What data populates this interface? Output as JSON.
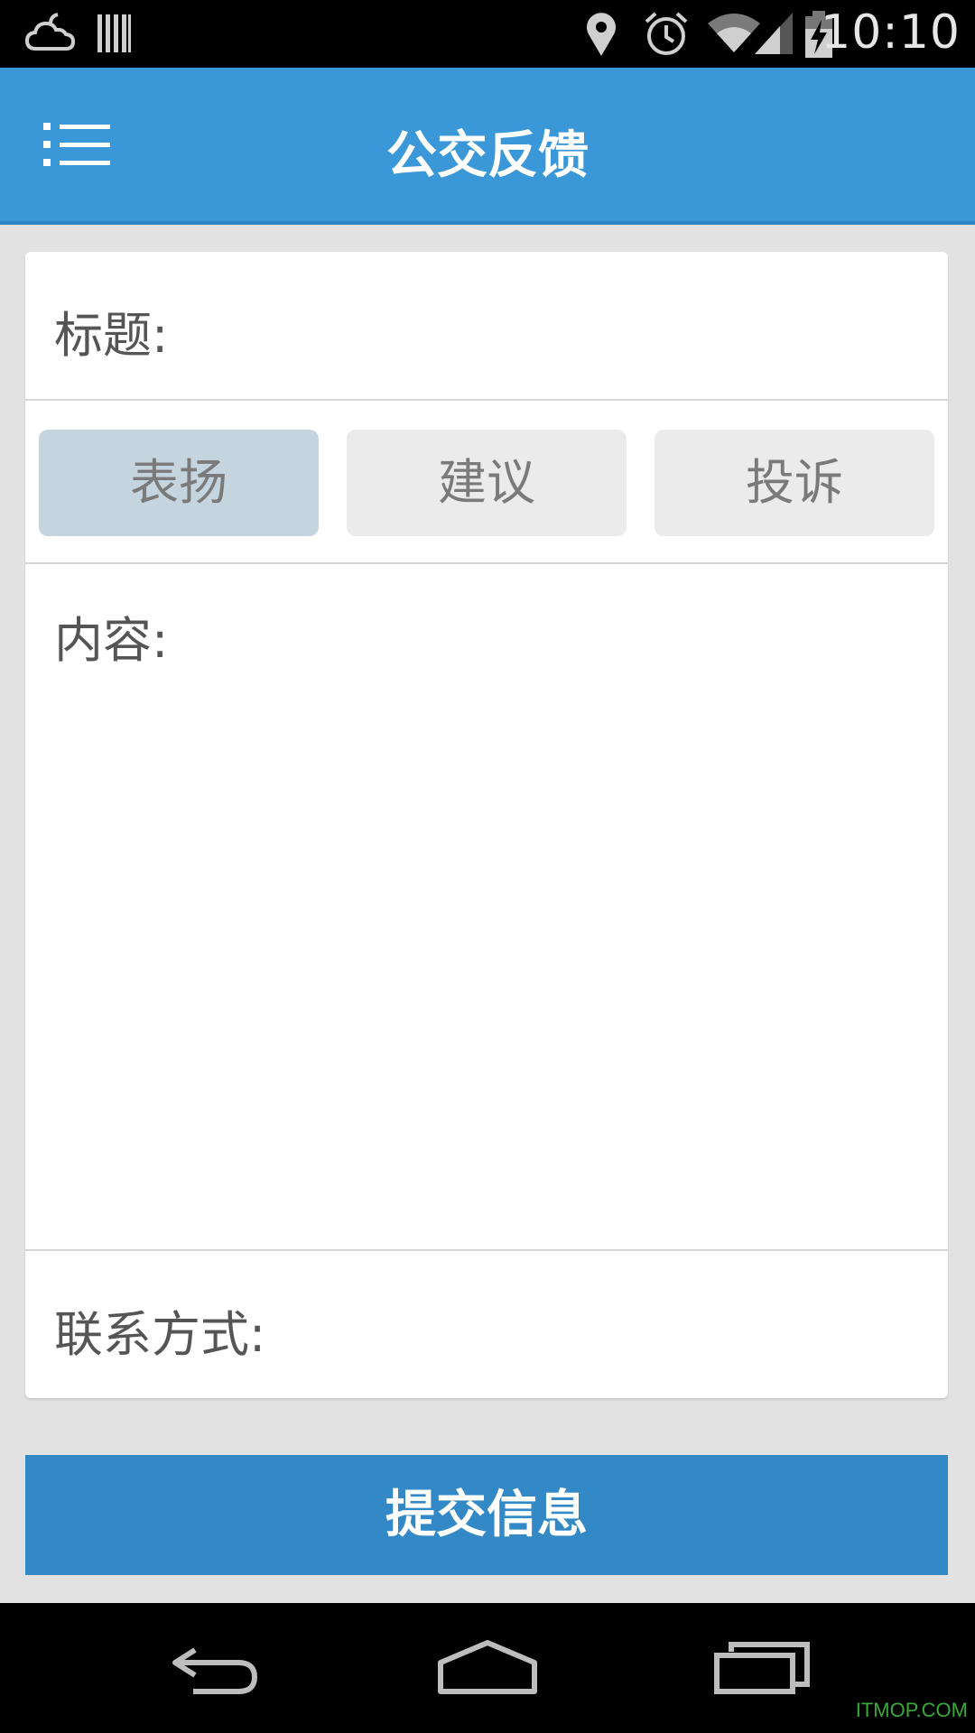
{
  "status_bar": {
    "time": "10:10",
    "icons": [
      "weather-cloud-icon",
      "barcode-icon",
      "location-pin-icon",
      "alarm-icon",
      "wifi-icon",
      "signal-icon",
      "battery-charging-icon"
    ]
  },
  "app_bar": {
    "title": "公交反馈",
    "menu_icon": "menu-list-icon"
  },
  "form": {
    "title_label": "标题:",
    "type_options": [
      {
        "label": "表扬",
        "selected": true
      },
      {
        "label": "建议",
        "selected": false
      },
      {
        "label": "投诉",
        "selected": false
      }
    ],
    "content_label": "内容:",
    "contact_label": "联系方式:"
  },
  "submit_label": "提交信息",
  "nav_bar": {
    "buttons": [
      "back-icon",
      "home-icon",
      "recent-apps-icon"
    ]
  },
  "watermark": "ITMOP.COM",
  "colors": {
    "app_bar": "#3a97d8",
    "submit": "#3388c6",
    "selected_option": "#c5d5e0",
    "unselected_option": "#ebebeb"
  }
}
